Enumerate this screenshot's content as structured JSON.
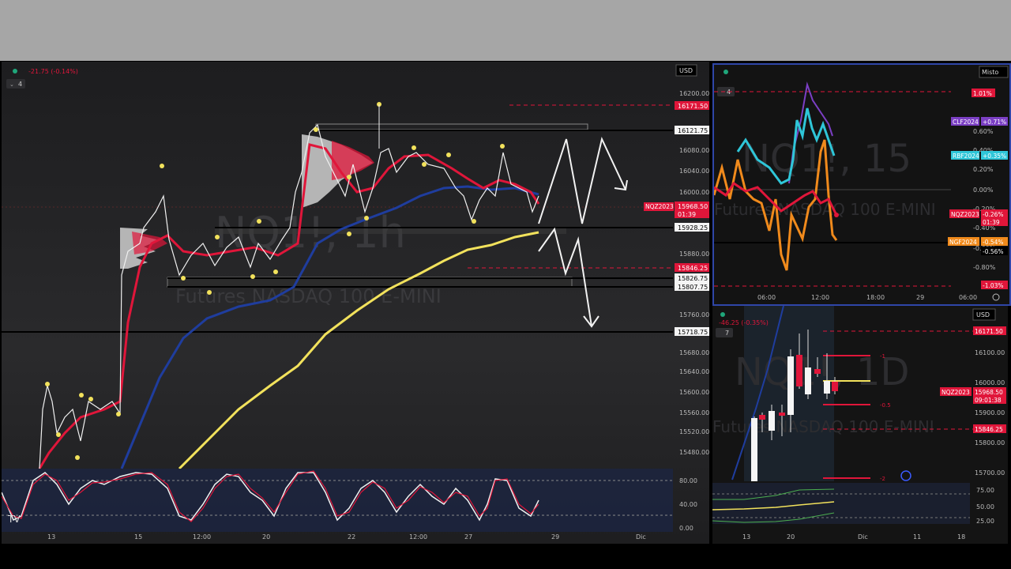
{
  "main_chart": {
    "watermark_symbol": "NQ1!, 1h",
    "watermark_name": "Futures NASDAQ 100 E-MINI",
    "change_text": "-21.75 (-0.14%)",
    "layer_count": "4",
    "currency": "USD",
    "price_axis": [
      "16200.00",
      "16080.00",
      "16040.00",
      "16000.00",
      "15880.00",
      "15760.00",
      "15680.00",
      "15640.00",
      "15600.00",
      "15560.00",
      "15520.00",
      "15480.00"
    ],
    "price_tags": [
      {
        "text": "16171.50",
        "style": "red"
      },
      {
        "text": "16121.75",
        "style": "black"
      },
      {
        "text": "15968.50",
        "style": "red"
      },
      {
        "text": "01:39",
        "style": "red"
      },
      {
        "text": "15928.25",
        "style": "black"
      },
      {
        "text": "15846.25",
        "style": "red"
      },
      {
        "text": "15826.75",
        "style": "black"
      },
      {
        "text": "15807.75",
        "style": "black"
      },
      {
        "text": "15718.75",
        "style": "black"
      }
    ],
    "symbol_tag": "NQZ2023",
    "time_axis": [
      "13",
      "15",
      "12:00",
      "20",
      "22",
      "12:00",
      "27",
      "29",
      "Dic"
    ],
    "oscillator_axis": [
      "80.00",
      "40.00",
      "0.00"
    ]
  },
  "compare_chart": {
    "watermark_symbol": "NQ1!, 15",
    "watermark_name": "Futures NASDAQ 100 E-MINI",
    "mode": "Misto",
    "layer_count": "4",
    "pct_axis": [
      "0.60%",
      "0.40%",
      "0.20%",
      "0.00%",
      "-0.20%",
      "-0.40%",
      "-0.60%",
      "-0.80%"
    ],
    "tags": [
      {
        "text": "1.01%",
        "color": "#e0163a"
      },
      {
        "text": "CLF2024",
        "color": "#7b3fc4"
      },
      {
        "text": "+0.71%",
        "color": "#7b3fc4"
      },
      {
        "text": "RBF2024",
        "color": "#2fc6d8"
      },
      {
        "text": "+0.35%",
        "color": "#2fc6d8"
      },
      {
        "text": "NQZ2023",
        "color": "#e0163a"
      },
      {
        "text": "-0.26%",
        "color": "#e0163a"
      },
      {
        "text": "01:39",
        "color": "#e0163a"
      },
      {
        "text": "NGF2024",
        "color": "#f08a1c"
      },
      {
        "text": "-0.54%",
        "color": "#f08a1c"
      },
      {
        "text": "-0.56%",
        "color": "#000000"
      },
      {
        "text": "-1.03%",
        "color": "#e0163a"
      }
    ],
    "time_axis": [
      "06:00",
      "12:00",
      "18:00",
      "29",
      "06:00"
    ]
  },
  "daily_chart": {
    "watermark_symbol": "NQ1!, 1D",
    "watermark_name": "Futures NASDAQ 100 E-MINI",
    "change_text": "-46.25 (-0.35%)",
    "currency": "USD",
    "layer_count": "7",
    "price_axis": [
      "16100.00",
      "16000.00",
      "15900.00",
      "15800.00",
      "15700.00"
    ],
    "tags": [
      {
        "text": "16171.50",
        "style": "red"
      },
      {
        "text": "NQZ2023",
        "style": "red"
      },
      {
        "text": "15968.50",
        "style": "red"
      },
      {
        "text": "09:01:38",
        "style": "red"
      },
      {
        "text": "15846.25",
        "style": "red"
      }
    ],
    "level_labels": [
      "-1",
      "-0.5",
      "-2"
    ],
    "osc_axis": [
      "75.00",
      "50.00",
      "25.00"
    ],
    "time_axis": [
      "13",
      "20",
      "Dic",
      "11",
      "18"
    ]
  },
  "chart_data": [
    {
      "type": "line",
      "title": "NQ1!, 1h",
      "series": [
        {
          "name": "price",
          "values": [
            15450,
            15500,
            15600,
            15540,
            15580,
            15560,
            15590,
            15620,
            15900,
            15920,
            15900,
            15880,
            15860,
            15870,
            15860,
            15880,
            15850,
            15900,
            16080,
            16100,
            16060,
            16020,
            16050,
            16060,
            16060,
            16040,
            16000,
            16020,
            15960,
            16020,
            16000,
            15990,
            15980,
            15968
          ]
        },
        {
          "name": "ma-blue",
          "values": [
            15400,
            15450,
            15500,
            15550,
            15600,
            15650,
            15700,
            15740,
            15780,
            15800,
            15830,
            15860,
            15900,
            15930,
            15950,
            15970,
            15990,
            16000,
            16005,
            16000,
            15995
          ]
        },
        {
          "name": "ma-yellow",
          "values": [
            15400,
            15450,
            15500,
            15560,
            15620,
            15680,
            15730,
            15770,
            15810,
            15840,
            15870,
            15890,
            15905,
            15918,
            15928
          ]
        }
      ],
      "ylim": [
        15440,
        16220
      ]
    }
  ]
}
